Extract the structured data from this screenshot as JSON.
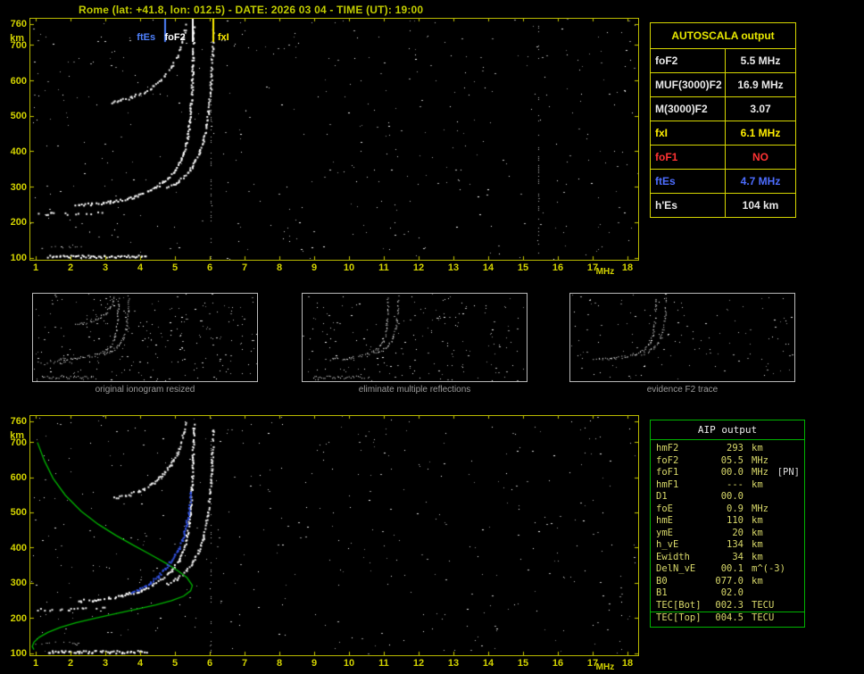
{
  "header": {
    "title": "Rome (lat: +41.8, lon: 012.5) - DATE: 2026 03 04 - TIME (UT): 19:00"
  },
  "theme": {
    "background": "#000000",
    "title_color": "#c2cc00",
    "axis_color": "#d3d300",
    "plot_border": "#b9b900",
    "autoscala_border": "#d6d600",
    "aip_border": "#00b400",
    "aip_text": "#d9d96a",
    "caption_color": "#9a9a9a",
    "thumb_border": "#b9b9b9"
  },
  "autoscala": {
    "title": "AUTOSCALA output",
    "rows": [
      {
        "label": "foF2",
        "value": "5.5 MHz",
        "color": "#e8e8e8"
      },
      {
        "label": "MUF(3000)F2",
        "value": "16.9 MHz",
        "color": "#e8e8e8"
      },
      {
        "label": "M(3000)F2",
        "value": "3.07",
        "color": "#e8e8e8"
      },
      {
        "label": "fxI",
        "value": "6.1 MHz",
        "color": "#ffee00"
      },
      {
        "label": "foF1",
        "value": "NO",
        "color": "#ff3333"
      },
      {
        "label": "ftEs",
        "value": "4.7 MHz",
        "color": "#4d6dff"
      },
      {
        "label": "h'Es",
        "value": "104   km",
        "color": "#e8e8e8"
      }
    ]
  },
  "aip": {
    "title": "AIP output",
    "rows": [
      {
        "label": "hmF2",
        "value": "293",
        "unit": "km"
      },
      {
        "label": "foF2",
        "value": "05.5",
        "unit": "MHz"
      },
      {
        "label": "foF1",
        "value": "00.0",
        "unit": "MHz",
        "extra": "[PN]"
      },
      {
        "label": "hmF1",
        "value": "---",
        "unit": "km"
      },
      {
        "label": "D1",
        "value": "00.0",
        "unit": ""
      },
      {
        "label": "foE",
        "value": "0.9",
        "unit": "MHz"
      },
      {
        "label": "hmE",
        "value": "110",
        "unit": "km"
      },
      {
        "label": "ymE",
        "value": "20",
        "unit": "km"
      },
      {
        "label": "h_vE",
        "value": "134",
        "unit": "km"
      },
      {
        "label": "Ewidth",
        "value": "34",
        "unit": "km"
      },
      {
        "label": "DelN_vE",
        "value": "00.1",
        "unit": "m^(-3)"
      },
      {
        "label": "B0",
        "value": "077.0",
        "unit": "km"
      },
      {
        "label": "B1",
        "value": "02.0",
        "unit": ""
      },
      {
        "label": "TEC[Bot]",
        "value": "002.3",
        "unit": "TECU",
        "rule": true
      },
      {
        "label": "TEC[Top]",
        "value": "004.5",
        "unit": "TECU"
      }
    ]
  },
  "middle": {
    "panels": [
      {
        "caption": "original ionogram resized"
      },
      {
        "caption": "eliminate multiple reflections"
      },
      {
        "caption": "evidence F2 trace"
      }
    ]
  },
  "chart_data": {
    "type": "scatter",
    "description": "Ionogram echo traces: virtual height (km) vs sounding frequency (MHz)",
    "scaled_values": {
      "foF2_MHz": 5.5,
      "ftEs_MHz": 4.7,
      "fxI_MHz": 6.1,
      "hEs_km": 104,
      "hmF2_km": 293
    },
    "traces": {
      "es_layer": {
        "color": "#ffffff",
        "style": "dots",
        "skip": 0.04,
        "points": [
          [
            1.35,
            106
          ],
          [
            4.15,
            106
          ]
        ]
      },
      "es_low": {
        "color": "#cccccc",
        "style": "dots",
        "skip": 0.65,
        "dot": 1,
        "points": [
          [
            1.0,
            131
          ],
          [
            2.35,
            131
          ]
        ]
      },
      "es_second_hop": {
        "color": "#e8e8e8",
        "style": "dots",
        "skip": 0.5,
        "points": [
          [
            1.05,
            226
          ],
          [
            2.95,
            230
          ]
        ]
      },
      "f2_o": {
        "color": "#ffffff",
        "style": "dots",
        "skip": 0.12,
        "points": [
          [
            2.1,
            250
          ],
          [
            2.6,
            254
          ],
          [
            3.1,
            260
          ],
          [
            3.6,
            269
          ],
          [
            4.0,
            281
          ],
          [
            4.35,
            296
          ],
          [
            4.65,
            315
          ],
          [
            4.9,
            338
          ],
          [
            5.1,
            367
          ],
          [
            5.25,
            402
          ],
          [
            5.35,
            445
          ],
          [
            5.42,
            500
          ],
          [
            5.47,
            570
          ],
          [
            5.5,
            660
          ],
          [
            5.52,
            750
          ]
        ]
      },
      "f2_x": {
        "color": "#f2f2f2",
        "style": "dots",
        "skip": 0.18,
        "points": [
          [
            4.75,
            298
          ],
          [
            5.05,
            315
          ],
          [
            5.3,
            336
          ],
          [
            5.5,
            362
          ],
          [
            5.68,
            396
          ],
          [
            5.82,
            440
          ],
          [
            5.92,
            495
          ],
          [
            6.0,
            565
          ],
          [
            6.05,
            645
          ],
          [
            6.09,
            745
          ]
        ]
      },
      "f2_second_hop": {
        "color": "#ededed",
        "style": "dots",
        "skip": 0.22,
        "points": [
          [
            3.15,
            542
          ],
          [
            3.55,
            550
          ],
          [
            3.95,
            563
          ],
          [
            4.3,
            582
          ],
          [
            4.6,
            606
          ],
          [
            4.85,
            636
          ],
          [
            5.05,
            672
          ],
          [
            5.2,
            714
          ],
          [
            5.3,
            758
          ]
        ]
      },
      "profile": {
        "color": "#00b400",
        "style": "line",
        "points": [
          [
            1.05,
            700
          ],
          [
            1.25,
            648
          ],
          [
            1.5,
            598
          ],
          [
            1.85,
            550
          ],
          [
            2.3,
            505
          ],
          [
            2.8,
            467
          ],
          [
            3.3,
            436
          ],
          [
            3.8,
            408
          ],
          [
            4.3,
            381
          ],
          [
            4.75,
            356
          ],
          [
            5.1,
            334
          ],
          [
            5.35,
            315
          ],
          [
            5.5,
            293
          ],
          [
            5.45,
            278
          ],
          [
            5.25,
            263
          ],
          [
            4.9,
            250
          ],
          [
            4.45,
            238
          ],
          [
            3.9,
            226
          ],
          [
            3.3,
            213
          ],
          [
            2.7,
            200
          ],
          [
            2.15,
            187
          ],
          [
            1.7,
            174
          ],
          [
            1.35,
            160
          ],
          [
            1.1,
            146
          ],
          [
            0.95,
            132
          ],
          [
            0.9,
            120
          ],
          [
            0.95,
            111
          ]
        ]
      },
      "restored": {
        "color": "#3354e6",
        "style": "dots",
        "skip": 0.06,
        "points": [
          [
            3.75,
            272
          ],
          [
            4.0,
            285
          ],
          [
            4.25,
            300
          ],
          [
            4.5,
            320
          ],
          [
            4.72,
            343
          ],
          [
            4.92,
            370
          ],
          [
            5.08,
            398
          ],
          [
            5.22,
            432
          ],
          [
            5.32,
            472
          ],
          [
            5.4,
            518
          ],
          [
            5.45,
            562
          ]
        ]
      }
    },
    "plots": [
      {
        "id": "main-ionogram",
        "canvas": "canvas-main",
        "xlim": [
          1,
          18
        ],
        "ylim": [
          100,
          760
        ],
        "pad": [
          6,
          12,
          6,
          2
        ],
        "xticks": [
          1,
          2,
          3,
          4,
          5,
          6,
          7,
          8,
          9,
          10,
          11,
          12,
          13,
          14,
          15,
          16,
          17,
          18
        ],
        "yticks": [
          100,
          200,
          300,
          400,
          500,
          600,
          700,
          760
        ],
        "x_unit": "MHz",
        "x_unit_at": 17.35,
        "y_unit": "km",
        "axis": true,
        "noise": 430,
        "seed": 11,
        "interference": [
          6.05,
          15.45
        ],
        "traces": [
          "es_layer",
          "es_low",
          "es_second_hop",
          "f2_o",
          "f2_x",
          "f2_second_hop"
        ],
        "markers": [
          {
            "label": "ftEs",
            "freq": 4.7,
            "color": "#4f82ff",
            "label_dx": -31
          },
          {
            "label": "foF2",
            "freq": 5.5,
            "color": "#ffffff",
            "label_dx": -31
          },
          {
            "label": "fxI",
            "freq": 6.1,
            "color": "#ffee00",
            "label_dx": 5
          }
        ]
      },
      {
        "id": "thumb-original",
        "canvas": "canvas-thumb1",
        "xlim": [
          1,
          13
        ],
        "ylim": [
          100,
          760
        ],
        "pad": [
          4,
          4,
          4,
          4
        ],
        "dot": 1,
        "noise": 250,
        "seed": 31,
        "traces": [
          "es_layer",
          "es_second_hop",
          "f2_o",
          "f2_x",
          "f2_second_hop"
        ]
      },
      {
        "id": "thumb-eliminate",
        "canvas": "canvas-thumb2",
        "xlim": [
          1,
          13
        ],
        "ylim": [
          100,
          760
        ],
        "pad": [
          4,
          4,
          4,
          4
        ],
        "dot": 1,
        "noise": 190,
        "seed": 41,
        "traces": [
          "es_layer",
          "f2_o",
          "f2_x"
        ]
      },
      {
        "id": "thumb-evidence",
        "canvas": "canvas-thumb3",
        "xlim": [
          1,
          13
        ],
        "ylim": [
          100,
          760
        ],
        "pad": [
          4,
          4,
          4,
          4
        ],
        "dot": 1,
        "noise": 130,
        "seed": 51,
        "traces": [
          "f2_o",
          "f2_x"
        ]
      },
      {
        "id": "bottom-ionogram",
        "canvas": "canvas-bottom",
        "xlim": [
          1,
          18
        ],
        "ylim": [
          100,
          760
        ],
        "pad": [
          6,
          12,
          6,
          2
        ],
        "xticks": [
          1,
          2,
          3,
          4,
          5,
          6,
          7,
          8,
          9,
          10,
          11,
          12,
          13,
          14,
          15,
          16,
          17,
          18
        ],
        "yticks": [
          100,
          200,
          300,
          400,
          500,
          600,
          700,
          760
        ],
        "x_unit": "MHz",
        "x_unit_at": 17.35,
        "y_unit": "km",
        "axis": true,
        "noise": 430,
        "seed": 23,
        "interference": [
          6.05
        ],
        "traces": [
          "es_layer",
          "es_low",
          "es_second_hop",
          "f2_o",
          "f2_x",
          "f2_second_hop",
          "profile",
          "restored"
        ]
      }
    ]
  }
}
